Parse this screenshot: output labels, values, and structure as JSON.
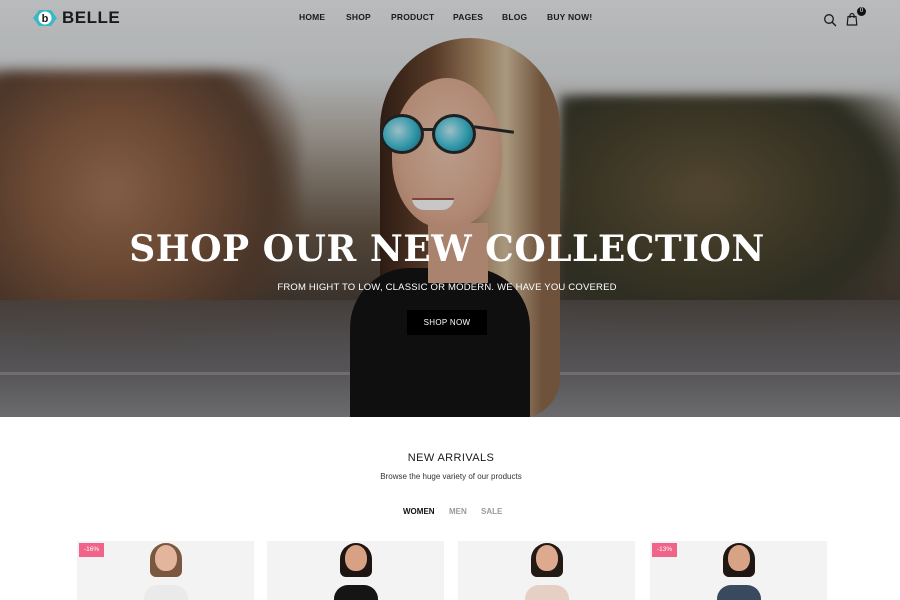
{
  "brand": {
    "logo_letter": "b",
    "name": "BELLE",
    "accent": "#3bb8c3"
  },
  "nav": {
    "items": [
      "HOME",
      "SHOP",
      "PRODUCT",
      "PAGES",
      "BLOG",
      "BUY NOW!"
    ]
  },
  "header_icons": {
    "search": "search-icon",
    "cart": "cart-icon",
    "cart_count": "0"
  },
  "hero": {
    "title": "SHOP OUR NEW COLLECTION",
    "subtitle": "FROM HIGHT TO LOW, CLASSIC OR MODERN. WE HAVE YOU COVERED",
    "button_label": "SHOP NOW"
  },
  "arrivals": {
    "title": "NEW ARRIVALS",
    "subtitle": "Browse the huge variety of our products",
    "tabs": [
      "WOMEN",
      "MEN",
      "SALE"
    ],
    "active_tab": "WOMEN",
    "badges": [
      "-16%",
      "-13%"
    ],
    "badge_color": "#f0648a"
  }
}
